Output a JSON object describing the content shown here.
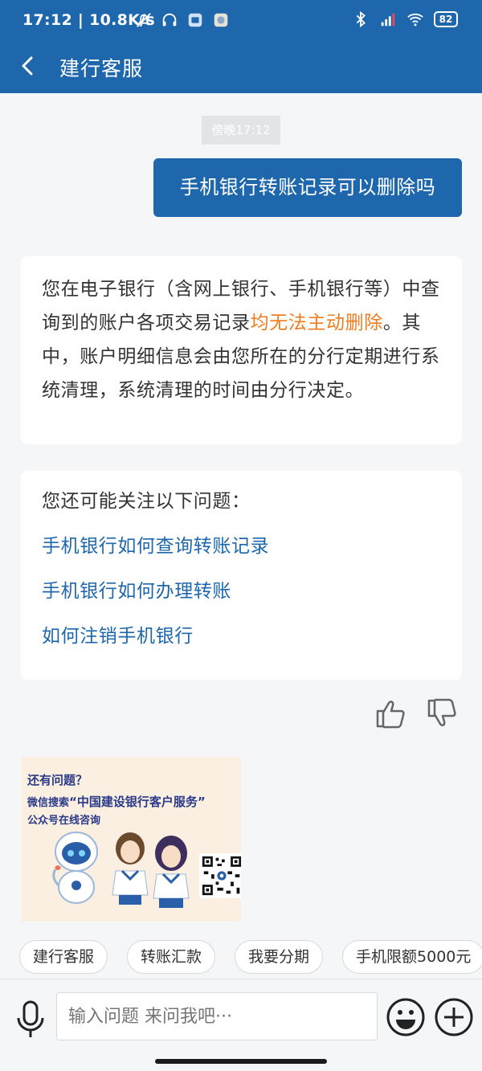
{
  "status_bar": {
    "time": "17:12",
    "speed": "10.8K/s",
    "battery": "82"
  },
  "header": {
    "title": "建行客服"
  },
  "chat": {
    "timestamp": "傍晚17:12",
    "user_message": "手机银行转账记录可以删除吗",
    "answer": {
      "before": "您在电子银行（含网上银行、手机银行等）中查询到的账户各项交易记录",
      "highlight": "均无法主动删除",
      "after": "。其中，账户明细信息会由您所在的分行定期进行系统清理，系统清理的时间由分行决定。"
    },
    "related": {
      "heading": "您还可能关注以下问题：",
      "items": [
        "手机银行如何查询转账记录",
        "手机银行如何办理转账",
        "如何注销手机银行"
      ]
    }
  },
  "promo": {
    "line1": "还有问题？",
    "line2_prefix": "微信搜索",
    "line2_name": "“中国建设银行客户服务”",
    "line3": "公众号在线咨询"
  },
  "quick_chips": [
    "建行客服",
    "转账汇款",
    "我要分期",
    "手机限额5000元"
  ],
  "input": {
    "placeholder": "输入问题 来问我吧···"
  },
  "colors": {
    "brand": "#1f67ad",
    "highlight": "#f07c1f",
    "link": "#1f67ad"
  },
  "icons": [
    "back-icon",
    "microphone-icon",
    "emoji-icon",
    "plus-icon",
    "thumbs-up-icon",
    "thumbs-down-icon"
  ]
}
